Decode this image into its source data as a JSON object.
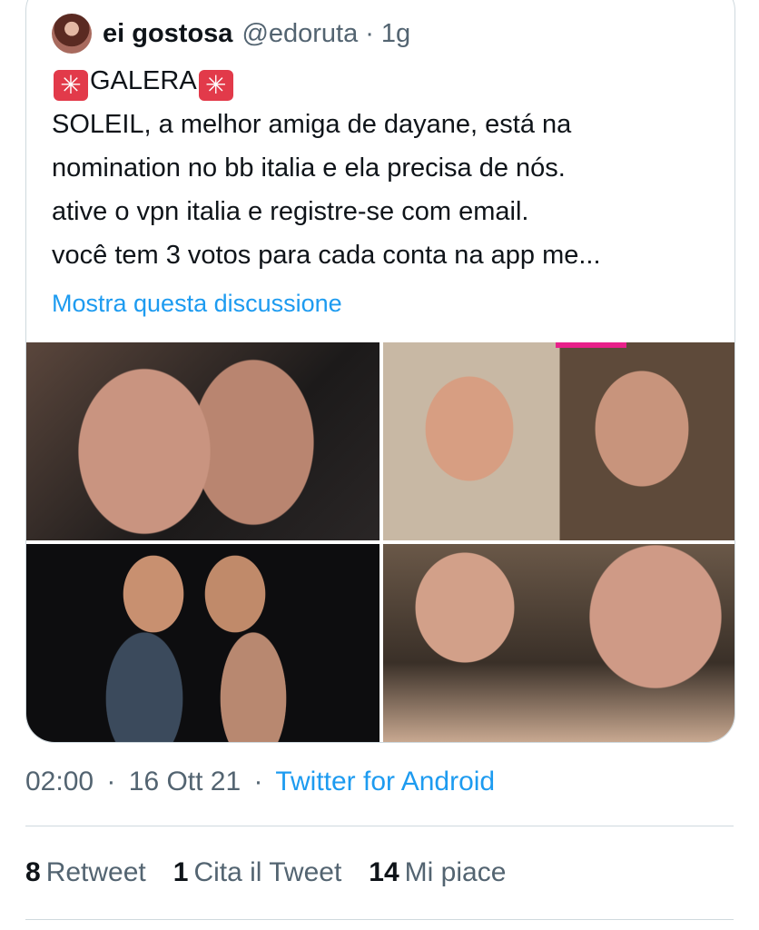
{
  "quoted_tweet": {
    "display_name": "ei gostosa",
    "handle": "@edoruta",
    "separator": "·",
    "time_ago": "1g",
    "siren_glyph": "✳",
    "text_line_1_word": "GALERA",
    "text_lines": [
      "SOLEIL, a melhor amiga de dayane, está na",
      "nomination no bb italia e ela precisa de nós.",
      "ative o vpn italia e registre-se com email.",
      "você tem 3 votos para cada conta na app me..."
    ],
    "show_thread": "Mostra questa discussione"
  },
  "meta": {
    "time": "02:00",
    "separator": "·",
    "date": "16 Ott 21",
    "source": "Twitter for Android"
  },
  "stats": {
    "retweets_count": "8",
    "retweets_label": "Retweet",
    "quotes_count": "1",
    "quotes_label": "Cita il Tweet",
    "likes_count": "14",
    "likes_label": "Mi piace"
  },
  "colors": {
    "link": "#1d9bf0",
    "secondary_text": "#536471",
    "border": "#cfd9de",
    "siren": "#e23a4a"
  }
}
